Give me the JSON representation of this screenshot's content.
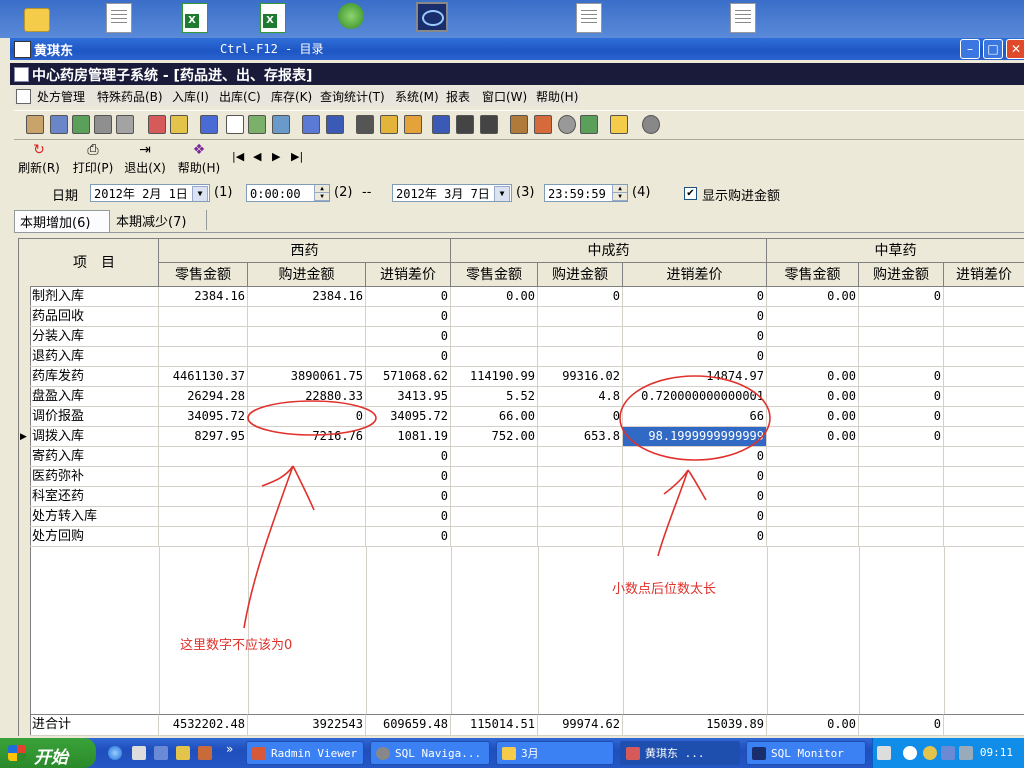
{
  "window": {
    "user": "黄琪东",
    "caption": "Ctrl-F12 - 目录",
    "doc_title": "中心药房管理子系统 - [药品进、出、存报表]"
  },
  "menu": [
    "处方管理",
    "特殊药品(B)",
    "入库(I)",
    "出库(C)",
    "库存(K)",
    "查询统计(T)",
    "系统(M)",
    "报表",
    "窗口(W)",
    "帮助(H)"
  ],
  "buttons": {
    "refresh": "刷新(R)",
    "print": "打印(P)",
    "exit": "退出(X)",
    "help": "帮助(H)"
  },
  "nav": {
    "first": "|◀",
    "prev": "◀",
    "next": "▶",
    "last": "▶|"
  },
  "filters": {
    "date_label": "日期",
    "start_date": "2012年 2月 1日",
    "hot1": "(1)",
    "start_time": "0:00:00",
    "hot2": "(2)",
    "sep": "--",
    "end_date": "2012年 3月 7日",
    "hot3": "(3)",
    "end_time": "23:59:59",
    "hot4": "(4)",
    "show_cost": "显示购进金额",
    "show_cost_checked": true
  },
  "tabs": [
    "本期增加(6)",
    "本期减少(7)"
  ],
  "table": {
    "item_header": "项　目",
    "groups": [
      "西药",
      "中成药",
      "中草药"
    ],
    "cols": [
      "零售金额",
      "购进金额",
      "进销差价",
      "零售金额",
      "购进金额",
      "进销差价",
      "零售金额",
      "购进金额",
      "进销差价"
    ],
    "rows": [
      {
        "label": "制剂入库",
        "v": [
          "2384.16",
          "2384.16",
          "0",
          "0.00",
          "0",
          "0",
          "0.00",
          "0",
          ""
        ]
      },
      {
        "label": "药品回收",
        "v": [
          "",
          "",
          "0",
          "",
          "",
          "0",
          "",
          "",
          ""
        ]
      },
      {
        "label": "分装入库",
        "v": [
          "",
          "",
          "0",
          "",
          "",
          "0",
          "",
          "",
          ""
        ]
      },
      {
        "label": "退药入库",
        "v": [
          "",
          "",
          "0",
          "",
          "",
          "0",
          "",
          "",
          ""
        ]
      },
      {
        "label": "药库发药",
        "v": [
          "4461130.37",
          "3890061.75",
          "571068.62",
          "114190.99",
          "99316.02",
          "14874.97",
          "0.00",
          "0",
          ""
        ]
      },
      {
        "label": "盘盈入库",
        "v": [
          "26294.28",
          "22880.33",
          "3413.95",
          "5.52",
          "4.8",
          "0.720000000000001",
          "0.00",
          "0",
          ""
        ]
      },
      {
        "label": "调价报盈",
        "v": [
          "34095.72",
          "0",
          "34095.72",
          "66.00",
          "0",
          "66",
          "0.00",
          "0",
          ""
        ]
      },
      {
        "label": "调拨入库",
        "v": [
          "8297.95",
          "7216.76",
          "1081.19",
          "752.00",
          "653.8",
          "98.1999999999999",
          "0.00",
          "0",
          ""
        ]
      },
      {
        "label": "寄药入库",
        "v": [
          "",
          "",
          "0",
          "",
          "",
          "0",
          "",
          "",
          ""
        ]
      },
      {
        "label": "医药弥补",
        "v": [
          "",
          "",
          "0",
          "",
          "",
          "0",
          "",
          "",
          ""
        ]
      },
      {
        "label": "科室还药",
        "v": [
          "",
          "",
          "0",
          "",
          "",
          "0",
          "",
          "",
          ""
        ]
      },
      {
        "label": "处方转入库",
        "v": [
          "",
          "",
          "0",
          "",
          "",
          "0",
          "",
          "",
          ""
        ]
      },
      {
        "label": "处方回购",
        "v": [
          "",
          "",
          "0",
          "",
          "",
          "0",
          "",
          "",
          ""
        ]
      }
    ],
    "total": {
      "label": "进合计",
      "v": [
        "4532202.48",
        "3922543",
        "609659.48",
        "115014.51",
        "99974.62",
        "15039.89",
        "0.00",
        "0",
        ""
      ]
    }
  },
  "annotations": {
    "left": "这里数字不应该为0",
    "right": "小数点后位数太长",
    "color": "#e0312c"
  },
  "taskbar": {
    "start": "开始",
    "tasks": [
      "Radmin Viewer",
      "SQL Naviga...",
      "3月",
      "黄琪东    ...",
      "SQL Monitor"
    ],
    "clock": "09:11"
  }
}
